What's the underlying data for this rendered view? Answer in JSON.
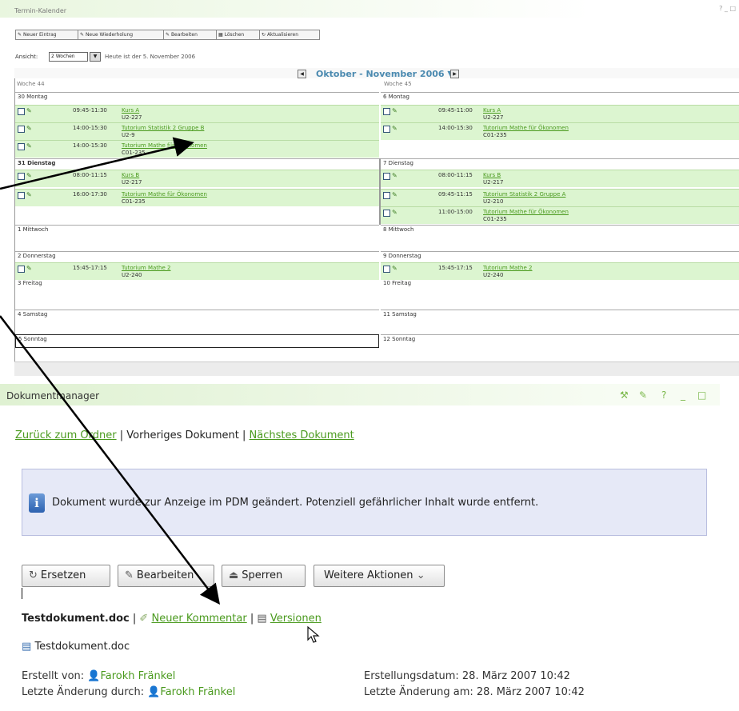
{
  "calendar_portlet": {
    "title": "Termin-Kalender",
    "window_controls": "? _ □",
    "toolbar": [
      {
        "label": "Neuer Eintrag"
      },
      {
        "label": "Neue Wiederholung"
      },
      {
        "label": "Bearbeiten"
      },
      {
        "label": "Löschen"
      },
      {
        "label": "Aktualisieren"
      }
    ],
    "view_label": "Ansicht:",
    "view_value": "2 Wochen",
    "view_extra": "Heute ist der 5. November 2006",
    "month_title": "Oktober - November 2006",
    "week_left": "Woche 44",
    "week_right": "Woche 45",
    "days_left": [
      "30 Montag",
      "31 Dienstag",
      "1 Mittwoch",
      "2 Donnerstag",
      "3 Freitag",
      "4 Samstag",
      "5 Sonntag"
    ],
    "days_right": [
      "6 Montag",
      "7 Dienstag",
      "8 Mittwoch",
      "9 Donnerstag",
      "10 Freitag",
      "11 Samstag",
      "12 Sonntag"
    ],
    "events_left": [
      {
        "time": "09:45-11:30",
        "title": "Kurs A",
        "room": "U2-227"
      },
      {
        "time": "14:00-15:30",
        "title": "Tutorium Statistik 2 Gruppe B",
        "room": "U2-9"
      },
      {
        "time": "14:00-15:30",
        "title": "Tutorium Mathe für Ökonomen",
        "room": "C01-235"
      },
      {
        "time": "08:00-11:15",
        "title": "Kurs B",
        "room": "U2-217"
      },
      {
        "time": "16:00-17:30",
        "title": "Tutorium Mathe für Ökonomen",
        "room": "C01-235"
      },
      {
        "time": "15:45-17:15",
        "title": "Tutorium Mathe 2",
        "room": "U2-240"
      }
    ],
    "events_right": [
      {
        "time": "09:45-11:00",
        "title": "Kurs A",
        "room": "U2-227"
      },
      {
        "time": "14:00-15:30",
        "title": "Tutorium Mathe für Ökonomen",
        "room": "C01-235"
      },
      {
        "time": "08:00-11:15",
        "title": "Kurs B",
        "room": "U2-217"
      },
      {
        "time": "09:45-11:15",
        "title": "Tutorium Statistik 2 Gruppe A",
        "room": "U2-210"
      },
      {
        "time": "11:00-15:00",
        "title": "Tutorium Mathe für Ökonomen",
        "room": "C01-235"
      },
      {
        "time": "15:45-17:15",
        "title": "Tutorium Mathe 2",
        "room": "U2-240"
      }
    ]
  },
  "docmanager": {
    "title": "Dokumentmanager",
    "nav_back": "Zurück zum Ordner",
    "nav_sep1": " | ",
    "nav_prev": "Vorheriges Dokument",
    "nav_sep2": " | ",
    "nav_next": "Nächstes Dokument",
    "info_message": "Dokument wurde zur Anzeige im PDM geändert. Potenziell gefährlicher Inhalt wurde entfernt.",
    "buttons": {
      "replace": "Ersetzen",
      "edit": "Bearbeiten",
      "lock": "Sperren",
      "more": "Weitere Aktionen"
    },
    "doc_name": "Testdokument.doc",
    "sep": " | ",
    "new_comment": "Neuer Kommentar",
    "versions": "Versionen",
    "file_name": "Testdokument.doc",
    "created_by_label": "Erstellt von:",
    "created_by": "Farokh Fränkel",
    "modified_by_label": "Letzte Änderung durch:",
    "modified_by": "Farokh Fränkel",
    "created_date_label": "Erstellungsdatum:",
    "created_date": "28. März 2007 10:42",
    "modified_date_label": "Letzte Änderung am:",
    "modified_date": "28. März 2007 10:42"
  },
  "colors": {
    "accent_green": "#4a9a1e",
    "event_bg": "#dcf5d0",
    "info_bg": "#e6e9f7"
  }
}
